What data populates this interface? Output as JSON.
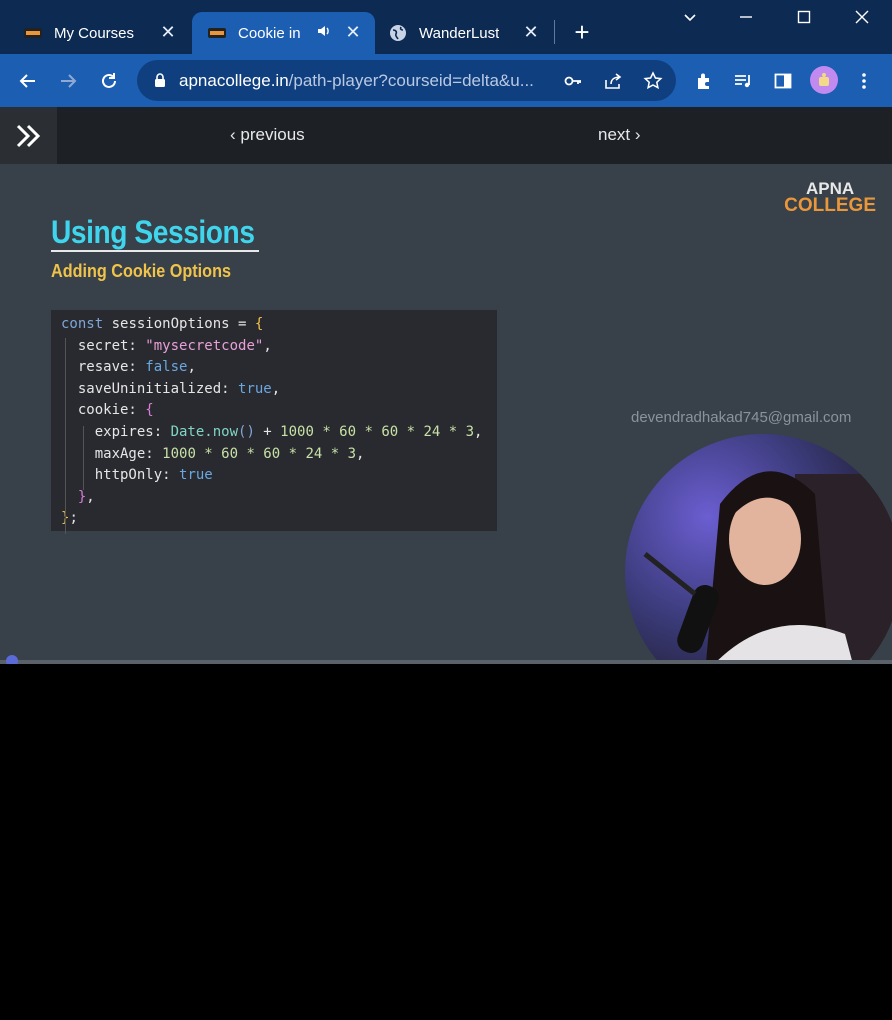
{
  "tabs": [
    {
      "label": "My Courses",
      "active": false,
      "favicon": "apna-college-icon"
    },
    {
      "label": "Cookie in S",
      "active": true,
      "favicon": "apna-college-icon",
      "audio": true
    },
    {
      "label": "WanderLust",
      "active": false,
      "favicon": "globe-icon"
    }
  ],
  "toolbar": {
    "url_domain": "apnacollege.in",
    "url_path": "/path-player?courseid=delta&u..."
  },
  "player": {
    "previous_label": "previous",
    "next_label": "next"
  },
  "slide": {
    "logo_line1": "APNA",
    "logo_line2": "COLLEGE",
    "title": "Using Sessions",
    "subtitle": "Adding Cookie Options",
    "watermark": "devendradhakad745@gmail.com",
    "code": {
      "l1_kw": "const",
      "l1_name": " sessionOptions = ",
      "l1_open": "{",
      "l2_key": "  secret: ",
      "l2_val": "\"mysecretcode\"",
      "l2_end": ",",
      "l3_key": "  resave: ",
      "l3_val": "false",
      "l3_end": ",",
      "l4_key": "  saveUninitialized: ",
      "l4_val": "true",
      "l4_end": ",",
      "l5_key": "  cookie: ",
      "l5_open": "{",
      "l6_key": "    expires: ",
      "l6_fn": "Date.now",
      "l6_paren": "()",
      "l6_rest": " + ",
      "l6_nums": "1000 * 60 * 60 * 24 * 3",
      "l6_end": ",",
      "l7_key": "    maxAge: ",
      "l7_nums": "1000 * 60 * 60 * 24 * 3",
      "l7_end": ",",
      "l8_key": "    httpOnly: ",
      "l8_val": "true",
      "l9_close": "  }",
      "l9_end": ",",
      "l10_close": "}",
      "l10_end": ";"
    }
  },
  "progress": 0.01,
  "colors": {
    "tabbar": "#0c2a52",
    "toolbar": "#1c5fb2",
    "slide_bg": "#384049",
    "title": "#3fd5ec",
    "subtitle": "#f0c34b"
  }
}
